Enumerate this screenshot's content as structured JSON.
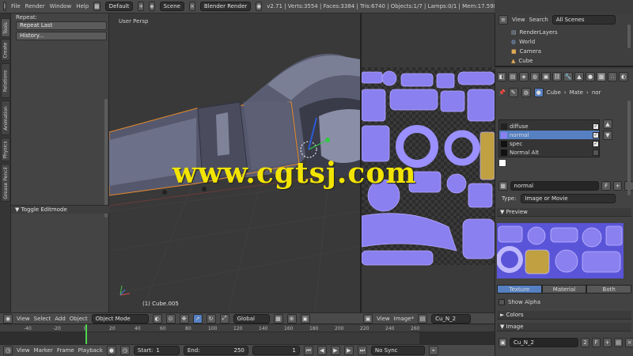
{
  "menubar": {
    "items": [
      "File",
      "Render",
      "Window",
      "Help"
    ],
    "layout": "Default",
    "scene": "Scene",
    "engine": "Blender Render",
    "stats": "v2.71 | Verts:3554 | Faces:3384 | Tris:6740 | Objects:1/7 | Lamps:0/1 | Mem:17.59M | Cube.005"
  },
  "tabs": [
    "Tools",
    "Create",
    "Relations",
    "Animation",
    "Physics",
    "Grease Pencil"
  ],
  "toolpanel": {
    "header": "Repeat:",
    "buttons": [
      "Repeat Last",
      "History..."
    ],
    "operator": "Toggle Editmode"
  },
  "viewport": {
    "view_label": "User Persp",
    "object_label": "(1) Cube.005"
  },
  "watermark": "www.cgtsj.com",
  "outliner": {
    "view": "View",
    "search": "Search",
    "filter": "All Scenes",
    "items": [
      "RenderLayers",
      "World",
      "Camera",
      "Cube"
    ]
  },
  "properties": {
    "breadcrumb": [
      "Cube",
      "Mate",
      "nor"
    ],
    "texture_slots": [
      {
        "name": "diffuse",
        "enabled": true
      },
      {
        "name": "normal",
        "enabled": true
      },
      {
        "name": "spec",
        "enabled": true
      },
      {
        "name": "Normal Alt",
        "enabled": false
      }
    ],
    "texture_name": "normal",
    "type_label": "Type:",
    "type_value": "Image or Movie",
    "preview_label": "Preview",
    "preview_tabs": [
      "Texture",
      "Material",
      "Both"
    ],
    "show_alpha": "Show Alpha",
    "colors_label": "Colors",
    "image_label": "Image",
    "image_name": "Cu_N_2"
  },
  "viewport_header": {
    "items": [
      "View",
      "Select",
      "Add",
      "Object"
    ],
    "mode": "Object Mode",
    "pivot": "Global"
  },
  "uv_header": {
    "items": [
      "View",
      "Image*"
    ],
    "image": "Cu_N_2"
  },
  "timeline": {
    "ticks": [
      "-40",
      "-20",
      "0",
      "20",
      "40",
      "60",
      "80",
      "100",
      "120",
      "140",
      "160",
      "180",
      "200",
      "220",
      "240",
      "260"
    ],
    "header_items": [
      "View",
      "Marker",
      "Frame",
      "Playback"
    ],
    "start_label": "Start:",
    "start_value": "1",
    "end_label": "End:",
    "end_value": "250",
    "current": "1",
    "sync": "No Sync"
  },
  "colors": {
    "accent_blue": "#5680c2",
    "selection_orange": "#e88a2a",
    "watermark": "#f2e400"
  }
}
